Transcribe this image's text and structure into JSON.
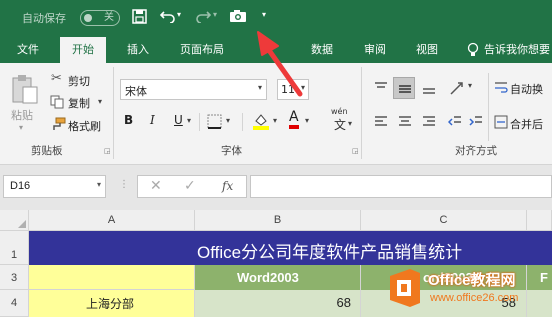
{
  "titlebar": {
    "autosave_label": "自动保存",
    "autosave_state": "关"
  },
  "tabs": [
    "文件",
    "开始",
    "插入",
    "页面布局",
    "数据",
    "审阅",
    "视图"
  ],
  "tell_me": "告诉我你想要",
  "ribbon": {
    "paste": "粘贴",
    "cut": "剪切",
    "copy": "复制",
    "format_painter": "格式刷",
    "clipboard": "剪贴板",
    "font_name": "宋体",
    "font_size": "11",
    "font_group": "字体",
    "wen": "wén",
    "wen_char": "文",
    "bold": "B",
    "italic": "I",
    "underline": "U",
    "font_color_letter": "A",
    "wrap": "自动换",
    "merge": "合并后",
    "align_group": "对齐方式"
  },
  "formula_bar": {
    "name_box": "D16",
    "fx": "fx"
  },
  "sheet": {
    "col_headers": [
      "A",
      "B",
      "C"
    ],
    "row_headers": [
      "1",
      "3",
      "4"
    ],
    "title": "Office分公司年度软件产品销售统计",
    "b3": "Word2003",
    "c3": "ord2003",
    "d3": "F",
    "a4": "上海分部",
    "b4": "68",
    "c4": "58"
  },
  "watermark": {
    "line1": "Office教程网",
    "line2": "www.office26.com"
  },
  "colors": {
    "brand": "#217346",
    "title_band": "#333399",
    "header_fill": "#8db26c",
    "label_fill": "#ffff99",
    "arrow": "#ee3a3a",
    "watermark_orange": "#f0781e"
  }
}
